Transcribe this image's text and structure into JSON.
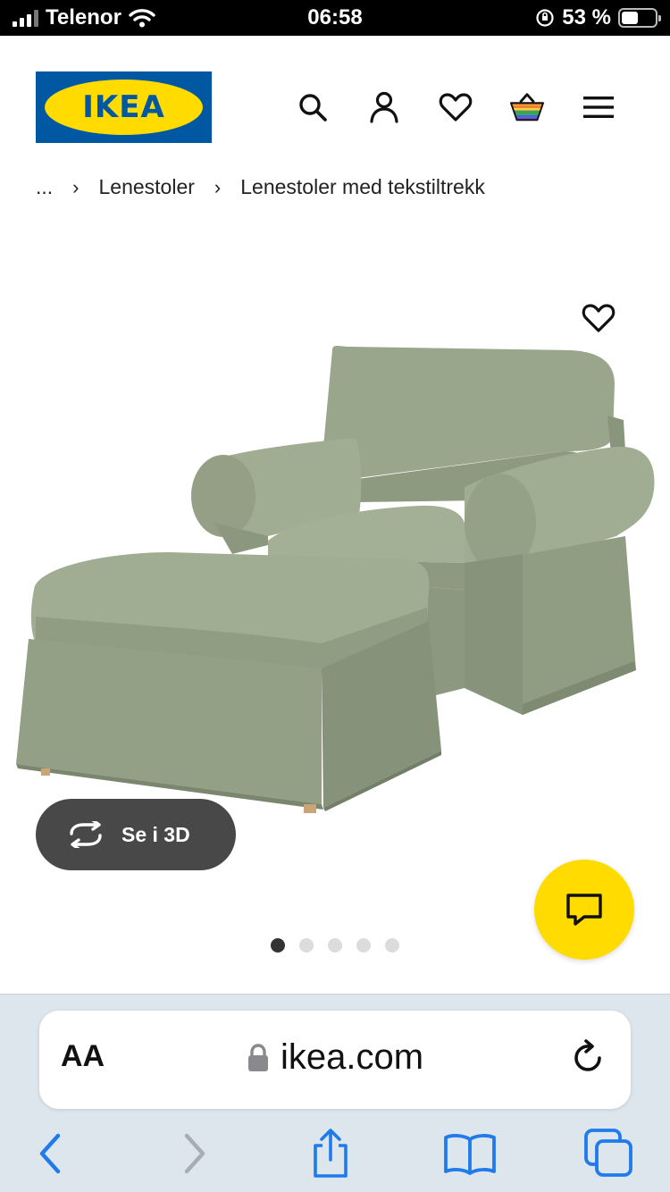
{
  "status_bar": {
    "carrier": "Telenor",
    "time": "06:58",
    "battery": "53 %"
  },
  "header": {
    "logo_text": "IKEA",
    "icons": [
      "search-icon",
      "user-icon",
      "heart-icon",
      "cart-icon",
      "menu-icon"
    ]
  },
  "breadcrumb": {
    "ellipsis": "...",
    "items": [
      "Lenestoler",
      "Lenestoler med tekstiltrekk"
    ]
  },
  "product": {
    "view_3d_label": "Se i 3D",
    "color_hex": "#9aa68b",
    "gallery": {
      "total": 5,
      "active": 1
    }
  },
  "browser": {
    "aa_label": "AA",
    "url": "ikea.com",
    "accent": "#1f7aec"
  },
  "colors": {
    "ikea_blue": "#0058a3",
    "ikea_yellow": "#ffdb00",
    "button_dark": "#484848"
  }
}
